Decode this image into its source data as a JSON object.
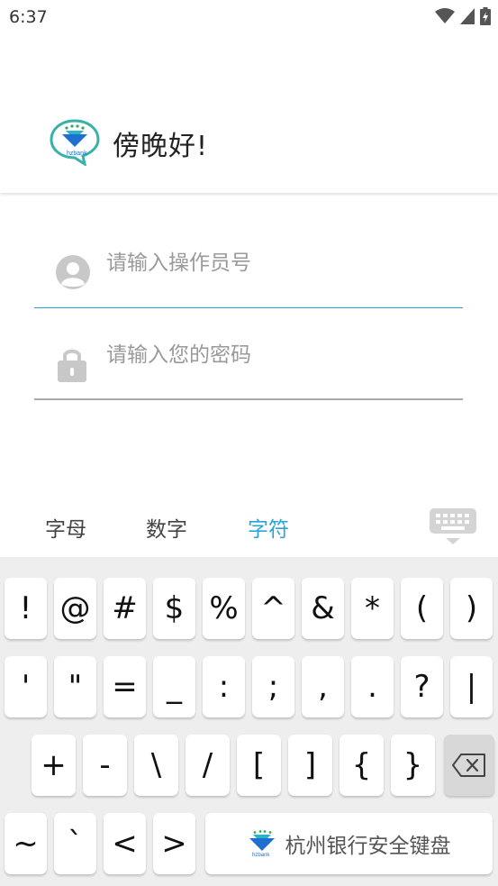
{
  "status_bar": {
    "time": "6:37"
  },
  "header": {
    "greeting": "傍晚好!"
  },
  "login": {
    "operator_placeholder": "请输入操作员号",
    "password_placeholder": "请输入您的密码"
  },
  "keyboard_tabs": [
    {
      "label": "字母"
    },
    {
      "label": "数字"
    },
    {
      "label": "字符"
    }
  ],
  "keyboard": {
    "row1": [
      "!",
      "@",
      "#",
      "$",
      "%",
      "^",
      "&",
      "*",
      "(",
      ")"
    ],
    "row2": [
      "'",
      "\"",
      "=",
      "_",
      ":",
      ";",
      ",",
      ".",
      "?",
      "|"
    ],
    "row3": [
      "+",
      "-",
      "\\",
      "/",
      "[",
      "]",
      "{",
      "}"
    ],
    "row4": [
      "~",
      "`",
      "<",
      ">"
    ],
    "brand_label": "杭州银行安全键盘",
    "delete_icon": "backspace-icon",
    "hide_icon": "keyboard-hide-icon"
  },
  "colors": {
    "accent": "#2ba4d8",
    "keyboard_bg": "#eeeeee",
    "key_bg": "#ffffff"
  }
}
